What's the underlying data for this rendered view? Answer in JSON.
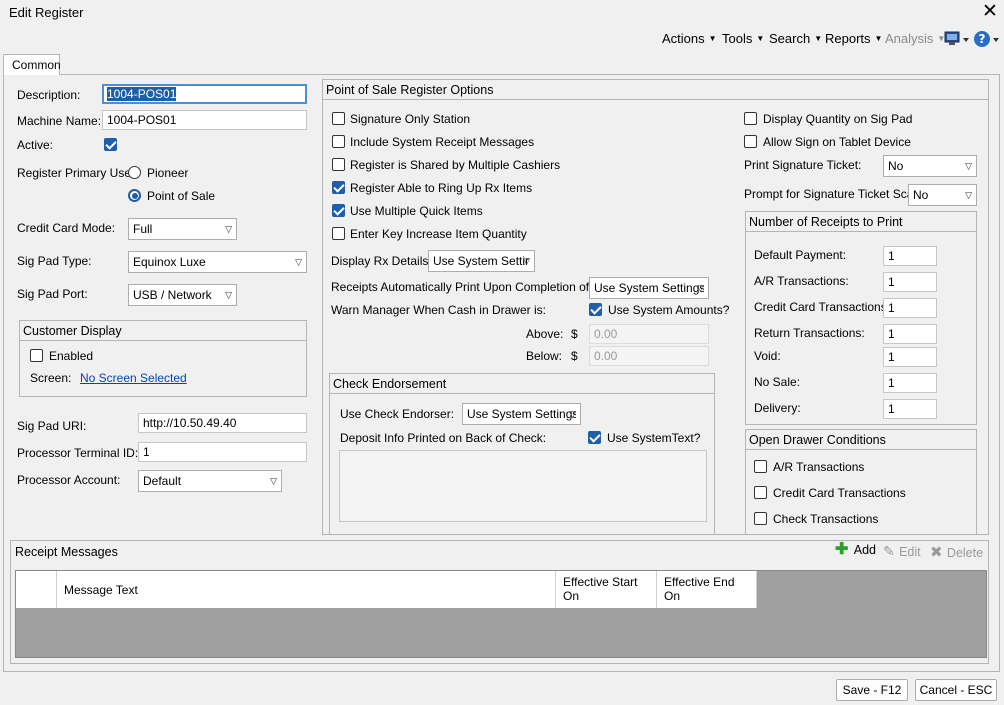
{
  "window": {
    "title": "Edit Register"
  },
  "menu": {
    "actions": "Actions",
    "tools": "Tools",
    "search": "Search",
    "reports": "Reports",
    "analysis": "Analysis"
  },
  "tabs": [
    {
      "label": "Common"
    }
  ],
  "general": {
    "description_label": "Description:",
    "description_value": "1004-POS01",
    "machine_name_label": "Machine Name:",
    "machine_name_value": "1004-POS01",
    "active_label": "Active:",
    "primary_use_label": "Register Primary Use:",
    "primary_use_options": [
      "Pioneer",
      "Point of Sale"
    ],
    "credit_card_mode_label": "Credit Card Mode:",
    "credit_card_mode_value": "Full",
    "sig_pad_type_label": "Sig Pad Type:",
    "sig_pad_type_value": "Equinox Luxe",
    "sig_pad_port_label": "Sig Pad Port:",
    "sig_pad_port_value": "USB / Network"
  },
  "customer_display": {
    "title": "Customer Display",
    "enabled_label": "Enabled",
    "screen_label": "Screen:",
    "screen_link": "No Screen Selected"
  },
  "processor": {
    "sig_pad_uri_label": "Sig Pad URI:",
    "sig_pad_uri_value": "http://10.50.49.40",
    "terminal_id_label": "Processor Terminal ID:",
    "terminal_id_value": "1",
    "account_label": "Processor Account:",
    "account_value": "Default"
  },
  "pos_options": {
    "title": "Point of Sale Register Options",
    "checkboxes": [
      "Signature Only Station",
      "Include System Receipt Messages",
      "Register is Shared by Multiple Cashiers",
      "Register Able to Ring Up Rx Items",
      "Use Multiple Quick Items",
      "Enter Key Increase Item Quantity"
    ],
    "display_rx_label": "Display Rx Details:",
    "display_rx_value": "Use System Settir",
    "receipts_auto_label": "Receipts Automatically Print Upon Completion of Sale:",
    "receipts_auto_value": "Use System Settings",
    "warn_manager_label": "Warn Manager When Cash in Drawer is:",
    "use_system_amounts_label": "Use System Amounts?",
    "above_label": "Above:",
    "below_label": "Below:",
    "currency_symbol": "$",
    "above_value": "0.00",
    "below_value": "0.00"
  },
  "check_endorsement": {
    "title": "Check Endorsement",
    "use_endorser_label": "Use Check Endorser:",
    "use_endorser_value": "Use System Settings",
    "deposit_info_label": "Deposit Info Printed on Back of Check:",
    "use_system_text_label": "Use SystemText?"
  },
  "sig_pad_options": {
    "display_qty_label": "Display Quantity on Sig Pad",
    "allow_tablet_label": "Allow Sign on Tablet Device",
    "print_sig_ticket_label": "Print Signature Ticket:",
    "print_sig_ticket_value": "No",
    "prompt_sig_scan_label": "Prompt for Signature Ticket Scan:",
    "prompt_sig_scan_value": "No"
  },
  "receipts_count": {
    "title": "Number of Receipts to Print",
    "rows": [
      {
        "label": "Default Payment:",
        "value": "1"
      },
      {
        "label": "A/R Transactions:",
        "value": "1"
      },
      {
        "label": "Credit Card Transactions:",
        "value": "1"
      },
      {
        "label": "Return Transactions:",
        "value": "1"
      },
      {
        "label": "Void:",
        "value": "1"
      },
      {
        "label": "No Sale:",
        "value": "1"
      },
      {
        "label": "Delivery:",
        "value": "1"
      }
    ]
  },
  "open_drawer": {
    "title": "Open Drawer Conditions",
    "items": [
      "A/R Transactions",
      "Credit Card Transactions",
      "Check Transactions"
    ]
  },
  "receipt_messages": {
    "title": "Receipt Messages",
    "add_label": "Add",
    "edit_label": "Edit",
    "delete_label": "Delete",
    "columns": [
      "Message Text",
      "Effective Start On",
      "Effective End On"
    ]
  },
  "footer": {
    "save_label": "Save - F12",
    "cancel_label": "Cancel - ESC"
  },
  "colors": {
    "accent": "#1f5ea8",
    "focus_border": "#4a90d9",
    "link": "#0645ad",
    "add_icon": "#2e9e2e"
  },
  "icons": {
    "close": "close-icon",
    "settings_flyout": "register-device-icon",
    "help": "help-icon",
    "add": "plus-icon",
    "edit": "pencil-icon",
    "delete": "x-icon"
  }
}
